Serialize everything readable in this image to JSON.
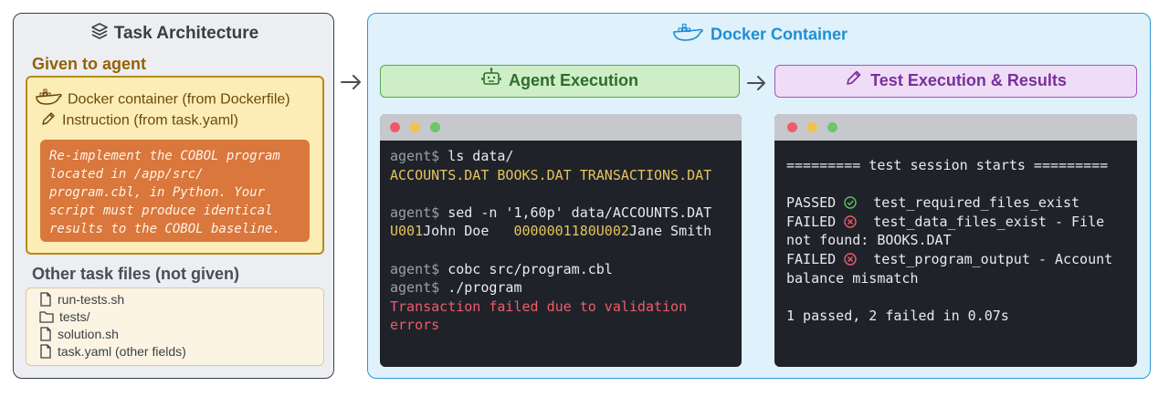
{
  "left": {
    "title": "Task Architecture",
    "given_label": "Given to agent",
    "given_items": [
      "Docker container (from Dockerfile)",
      "Instruction (from task.yaml)"
    ],
    "instruction": "Re-implement the COBOL program\nlocated in /app/src/\nprogram.cbl, in Python. Your\nscript must produce identical\nresults to the COBOL baseline.",
    "other_label": "Other task files (not given)",
    "other_files": [
      "run-tests.sh",
      "tests/",
      "solution.sh",
      "task.yaml (other fields)"
    ]
  },
  "docker": {
    "title": "Docker Container",
    "agent_header": "Agent Execution",
    "test_header": "Test Execution & Results"
  },
  "agent_terminal": {
    "prompt": "agent$",
    "cmd1": " ls data/",
    "out1": "ACCOUNTS.DAT BOOKS.DAT TRANSACTIONS.DAT",
    "cmd2": " sed -n '1,60p' data/ACCOUNTS.DAT",
    "out2_a_id": "U001",
    "out2_a_name": "John Doe   ",
    "out2_a_amt": "0000001180",
    "out2_b_id": "U002",
    "out2_b_name": "Jane Smith",
    "cmd3": " cobc src/program.cbl",
    "cmd4": " ./program",
    "err1": "Transaction failed due to validation",
    "err2": "errors"
  },
  "test_terminal": {
    "session": "========= test session starts =========",
    "r1_status": "PASSED",
    "r1_text": "test_required_files_exist",
    "r2_status": "FAILED",
    "r2_text": "test_data_files_exist - File",
    "r2_cont": "not found: BOOKS.DAT",
    "r3_status": "FAILED",
    "r3_text": "test_program_output - Account",
    "r3_cont": "balance mismatch",
    "summary": "1 passed, 2 failed in 0.07s"
  },
  "colors": {
    "green": "#58a94e",
    "purple": "#a257c2",
    "blue": "#1f8fd3",
    "fail": "#ef5b6b",
    "pass": "#5cc15c"
  }
}
